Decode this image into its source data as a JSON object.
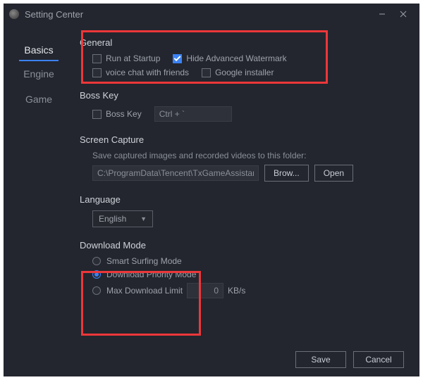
{
  "window": {
    "title": "Setting Center"
  },
  "sidebar": {
    "tabs": [
      "Basics",
      "Engine",
      "Game"
    ],
    "activeIndex": 0
  },
  "general": {
    "heading": "General",
    "runAtStartup": {
      "label": "Run at Startup",
      "checked": false
    },
    "hideWatermark": {
      "label": "Hide Advanced Watermark",
      "checked": true
    },
    "voiceChat": {
      "label": "voice chat with friends",
      "checked": false
    },
    "googleInstaller": {
      "label": "Google installer",
      "checked": false
    }
  },
  "bossKey": {
    "heading": "Boss Key",
    "enable": {
      "label": "Boss Key",
      "checked": false
    },
    "shortcut": "Ctrl + `"
  },
  "screenCapture": {
    "heading": "Screen Capture",
    "hint": "Save captured images and recorded videos to this folder:",
    "path": "C:\\ProgramData\\Tencent\\TxGameAssistant\\Snapshot",
    "browse": "Brow...",
    "open": "Open"
  },
  "language": {
    "heading": "Language",
    "selected": "English"
  },
  "downloadMode": {
    "heading": "Download Mode",
    "options": {
      "smart": "Smart Surfing Mode",
      "priority": "Download Priority Mode",
      "maxLimit": "Max Download Limit"
    },
    "selected": "priority",
    "limitValue": "0",
    "limitUnit": "KB/s"
  },
  "footer": {
    "save": "Save",
    "cancel": "Cancel"
  }
}
